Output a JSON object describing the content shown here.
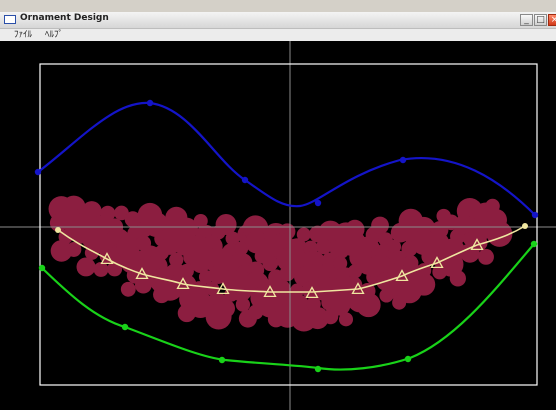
{
  "window": {
    "title": "Ornament Design",
    "controls": {
      "minimize": "_",
      "maximize": "□",
      "close": "×"
    }
  },
  "menu": {
    "items": [
      {
        "label": "ﾌｧｲﾙ"
      },
      {
        "label": "ﾍﾙﾌﾟ"
      }
    ]
  },
  "colors": {
    "canvas_background": "#000000",
    "frame": "#ffffff",
    "crosshair": "#8c8c8c",
    "top_curve": "#1414c8",
    "bottom_curve": "#19d219",
    "guide_curve": "#f0e6a0",
    "ornament_fill": "#8c1e40"
  }
}
